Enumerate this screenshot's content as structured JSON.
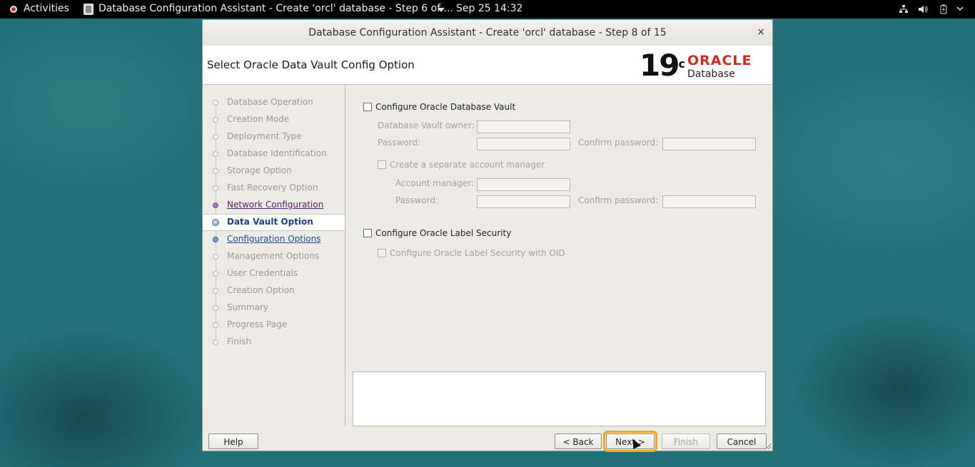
{
  "topbar": {
    "activities": "Activities",
    "app_title": "Database Configuration Assistant - Create 'orcl' database - Step 6 of ...",
    "clock": "Sep 25  14:32"
  },
  "dialog": {
    "window_title": "Database Configuration Assistant - Create 'orcl' database - Step 8 of 15",
    "close": "×",
    "page_title": "Select Oracle Data Vault Config Option",
    "logo": {
      "version": "19",
      "version_suffix": "c",
      "brand": "ORACLE",
      "product": "Database"
    }
  },
  "nav": {
    "items": [
      {
        "label": "Database Operation",
        "state": "disabled"
      },
      {
        "label": "Creation Mode",
        "state": "disabled"
      },
      {
        "label": "Deployment Type",
        "state": "disabled"
      },
      {
        "label": "Database Identification",
        "state": "disabled"
      },
      {
        "label": "Storage Option",
        "state": "disabled"
      },
      {
        "label": "Fast Recovery Option",
        "state": "disabled"
      },
      {
        "label": "Network Configuration",
        "state": "visited"
      },
      {
        "label": "Data Vault Option",
        "state": "current"
      },
      {
        "label": "Configuration Options",
        "state": "link"
      },
      {
        "label": "Management Options",
        "state": "disabled"
      },
      {
        "label": "User Credentials",
        "state": "disabled"
      },
      {
        "label": "Creation Option",
        "state": "disabled"
      },
      {
        "label": "Summary",
        "state": "disabled"
      },
      {
        "label": "Progress Page",
        "state": "disabled"
      },
      {
        "label": "Finish",
        "state": "disabled"
      }
    ]
  },
  "form": {
    "configure_vault": "Configure Oracle Database Vault",
    "vault_owner": "Database Vault owner:",
    "password": "Password:",
    "confirm_password": "Confirm password:",
    "separate_account_manager": "Create a separate account manager",
    "account_manager": "Account manager:",
    "password2": "Password:",
    "confirm_password2": "Confirm password:",
    "configure_label_security": "Configure Oracle Label Security",
    "label_security_oid": "Configure Oracle Label Security with OID"
  },
  "buttons": {
    "help": "Help",
    "back": "< Back",
    "next": "Next >",
    "finish": "Finish",
    "cancel": "Cancel"
  }
}
